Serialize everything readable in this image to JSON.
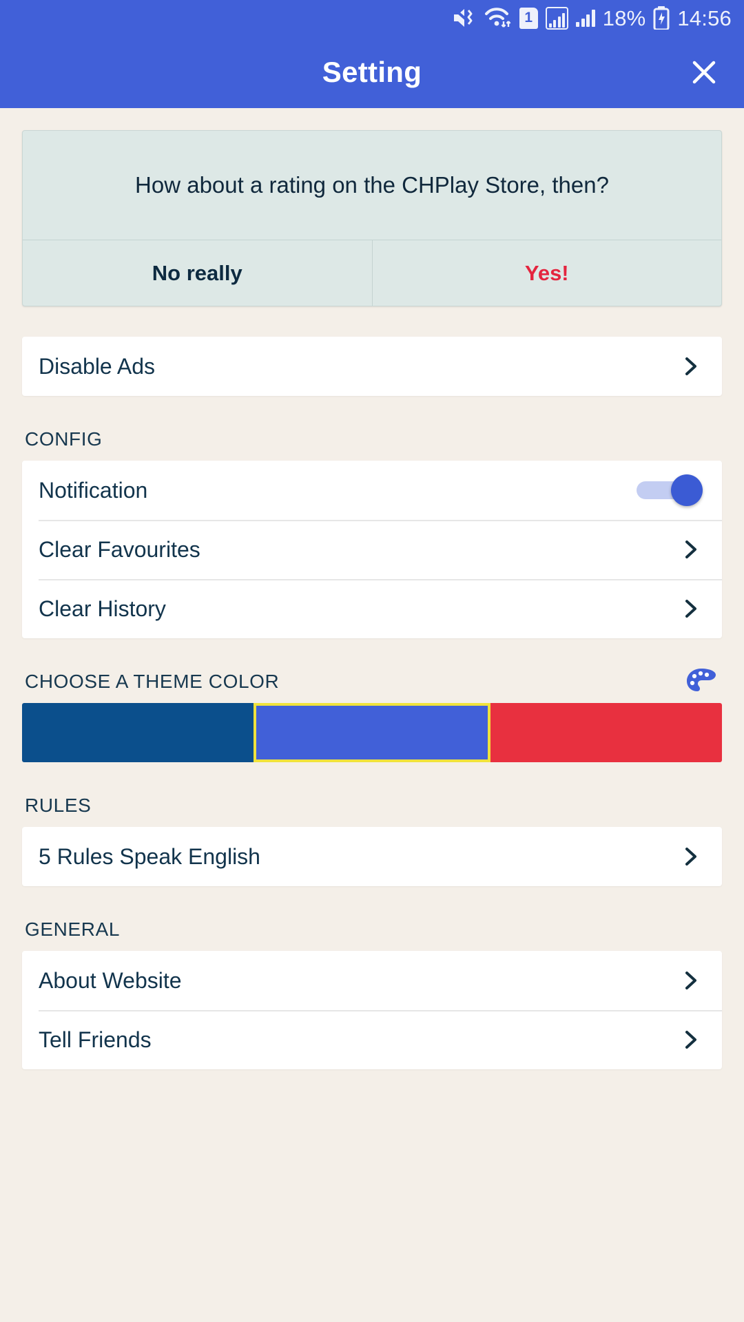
{
  "statusbar": {
    "icons": [
      "volume-mute-vibrate-icon",
      "wifi-data-transfer-icon",
      "sim-1-icon",
      "signal-boxed-icon",
      "signal-bars-icon",
      "battery-charging-icon"
    ],
    "sim_label": "1",
    "battery_text": "18%",
    "time": "14:56",
    "background": "#4160d8"
  },
  "header": {
    "title": "Setting",
    "close_icon": "close-icon",
    "background": "#4160d8",
    "title_color": "#ffffff"
  },
  "rating_dialog": {
    "message": "How about a rating on the CHPlay Store, then?",
    "decline_label": "No really",
    "accept_label": "Yes!",
    "background": "#dde8e6",
    "text_color": "#10283c",
    "accept_color": "#e4253f"
  },
  "ads": {
    "rows": [
      {
        "label": "Disable Ads",
        "chevron": "chevron-right-icon"
      }
    ]
  },
  "config": {
    "header": "CONFIG",
    "rows": [
      {
        "label": "Notification",
        "control": "toggle",
        "value": "on"
      },
      {
        "label": "Clear Favourites",
        "control": "chevron"
      },
      {
        "label": "Clear History",
        "control": "chevron"
      }
    ],
    "toggle_on_color": "#3b5bd4",
    "toggle_track_color": "#c3cdf2"
  },
  "theme": {
    "header": "CHOOSE A THEME COLOR",
    "palette_icon": "palette-icon",
    "swatches": [
      {
        "name": "dark-blue",
        "color": "#0b4f8c",
        "selected": false
      },
      {
        "name": "royal-blue",
        "color": "#4160d8",
        "selected": true
      },
      {
        "name": "red",
        "color": "#e8303f",
        "selected": false
      }
    ],
    "selection_border": "#f0e23c"
  },
  "rules": {
    "header": "RULES",
    "rows": [
      {
        "label": "5 Rules Speak English",
        "control": "chevron"
      }
    ]
  },
  "general": {
    "header": "GENERAL",
    "rows": [
      {
        "label": "About Website",
        "control": "chevron"
      },
      {
        "label": "Tell Friends",
        "control": "chevron"
      }
    ]
  },
  "colors": {
    "page_background": "#f4efe8",
    "card_background": "#ffffff",
    "label_text": "#12344c",
    "section_text": "#17384f"
  }
}
